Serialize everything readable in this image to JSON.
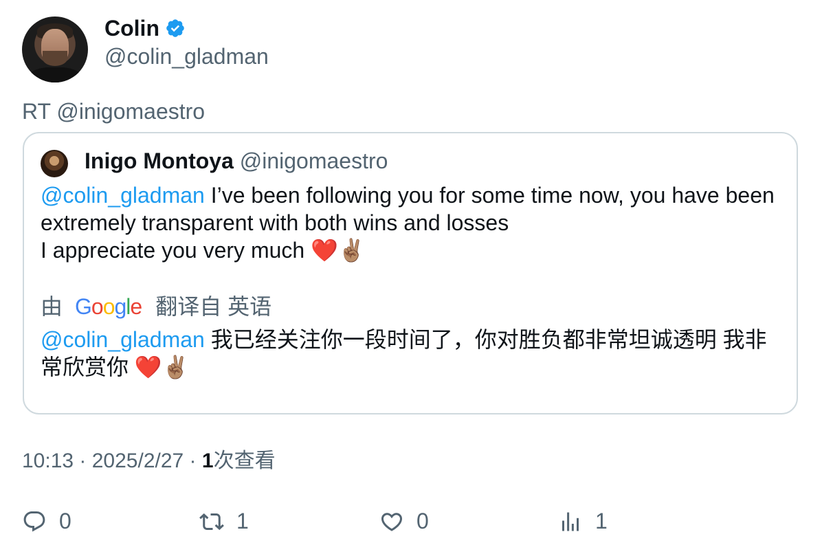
{
  "author": {
    "name": "Colin",
    "handle": "@colin_gladman",
    "verified_badge": "verified-badge-icon",
    "avatar_icon": "profile-photo"
  },
  "retweet_prefix": "RT @inigomaestro",
  "quoted": {
    "name": "Inigo Montoya",
    "handle": "@inigomaestro",
    "mention": "@colin_gladman",
    "text_line1": " I’ve been following you for some time now, you have been extremely transparent with both wins and losses",
    "text_line2": "I appreciate you very much",
    "emoji": "❤️✌🏽",
    "translation_by": "由",
    "translation_provider": "Google",
    "translation_from": "翻译自 英语",
    "translated_mention": "@colin_gladman",
    "translated_text": " 我已经关注你一段时间了，你对胜负都非常坦诚透明 我非常欣赏你"
  },
  "meta": {
    "time": "10:13",
    "date": "2025/2/27",
    "views_count": "1",
    "views_label": "次查看"
  },
  "actions": {
    "replies": "0",
    "retweets": "1",
    "likes": "0",
    "views": "1"
  },
  "colors": {
    "accent": "#1d9bf0",
    "muted": "#536471",
    "border": "#cfd9de"
  }
}
